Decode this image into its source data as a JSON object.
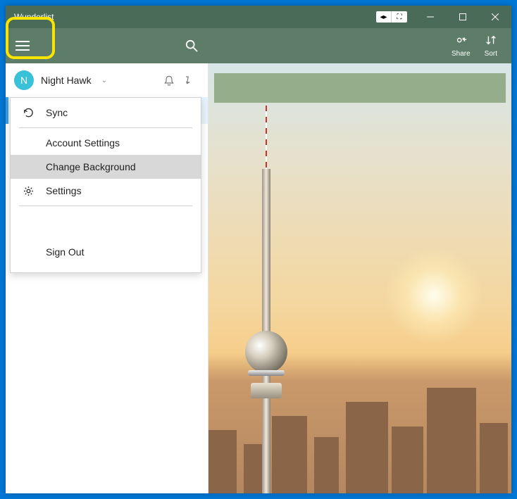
{
  "titlebar": {
    "title": "Wunderlist"
  },
  "appbar": {
    "actions": {
      "share_label": "Share",
      "sort_label": "Sort"
    }
  },
  "user": {
    "avatar_initial": "N",
    "display_name": "Night Hawk"
  },
  "sidebar": {
    "selected_list_label": ""
  },
  "menu": {
    "items": [
      {
        "label": "Sync",
        "icon": "refresh"
      },
      {
        "label": "Account Settings",
        "icon": ""
      },
      {
        "label": "Change Background",
        "icon": ""
      },
      {
        "label": "Settings",
        "icon": "gear"
      },
      {
        "label": "Sign Out",
        "icon": ""
      }
    ]
  }
}
